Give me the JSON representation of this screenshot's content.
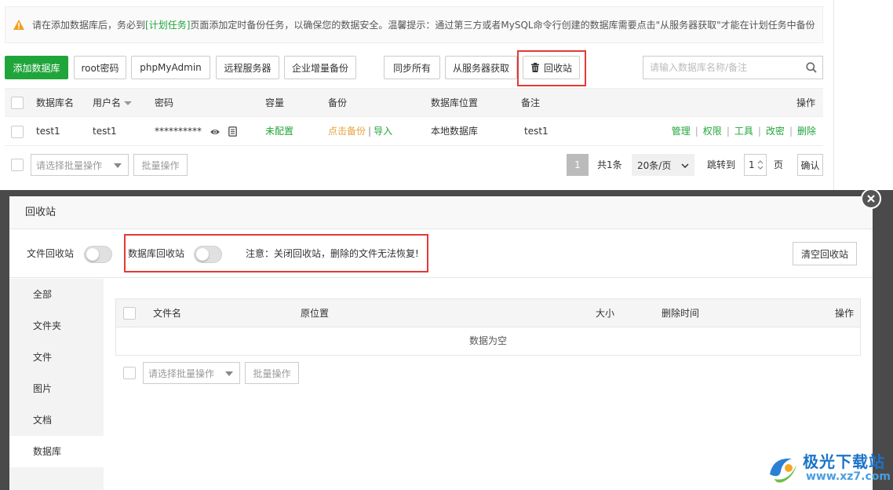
{
  "notice": {
    "text_before": "请在添加数据库后，务必到",
    "link": "[计划任务]",
    "text_after": "页面添加定时备份任务，以确保您的数据安全。温馨提示：通过第三方或者MySQL命令行创建的数据库需要点击\"从服务器获取\"才能在计划任务中备份"
  },
  "toolbar": {
    "add_db": "添加数据库",
    "root_pwd": "root密码",
    "phpmyadmin": "phpMyAdmin",
    "remote_server": "远程服务器",
    "incr_backup": "企业增量备份",
    "sync_all": "同步所有",
    "get_from_server": "从服务器获取",
    "recycle_bin": "回收站",
    "search_placeholder": "请输入数据库名称/备注"
  },
  "db_table": {
    "headers": {
      "name": "数据库名",
      "user": "用户名",
      "password": "密码",
      "capacity": "容量",
      "backup": "备份",
      "location": "数据库位置",
      "remark": "备注",
      "actions": "操作"
    },
    "rows": [
      {
        "name": "test1",
        "user": "test1",
        "password": "**********",
        "capacity": "未配置",
        "backup_link": "点击备份",
        "import_link": "导入",
        "location": "本地数据库",
        "remark": "test1",
        "actions": [
          "管理",
          "权限",
          "工具",
          "改密",
          "删除"
        ]
      }
    ]
  },
  "db_footer": {
    "batch_select": "请选择批量操作",
    "batch_btn": "批量操作",
    "page_current": "1",
    "total": "共1条",
    "per_page": "20条/页",
    "jump_to": "跳转到",
    "jump_value": "1",
    "page_unit": "页",
    "confirm": "确认"
  },
  "modal": {
    "title": "回收站",
    "file_recycle_label": "文件回收站",
    "db_recycle_label": "数据库回收站",
    "warning": "注意：关闭回收站，删除的文件无法恢复!",
    "clear_btn": "清空回收站",
    "side_items": [
      "全部",
      "文件夹",
      "文件",
      "图片",
      "文档",
      "数据库"
    ],
    "active_side_index": 5,
    "table_headers": {
      "filename": "文件名",
      "origin": "原位置",
      "size": "大小",
      "deleted_time": "删除时间",
      "actions": "操作"
    },
    "empty_text": "数据为空",
    "batch_select": "请选择批量操作",
    "batch_btn": "批量操作"
  },
  "watermark": {
    "name": "极光下载站",
    "url": "www.xz7.com"
  },
  "colors": {
    "primary": "#20a53a",
    "warning_box": "#e53935",
    "link_orange": "#e8a33b"
  }
}
